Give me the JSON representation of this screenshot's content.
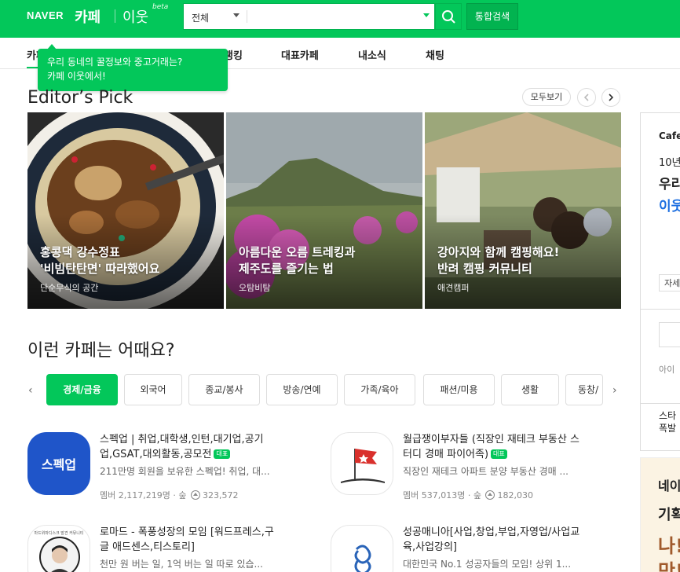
{
  "header": {
    "logo": "NAVER",
    "cafe": "카페",
    "town": "이웃",
    "beta": "beta",
    "search_scope": "전체",
    "search_placeholder": "",
    "integrated_search": "통합검색"
  },
  "nav": {
    "items": [
      "카페",
      "랭킹",
      "대표카페",
      "내소식",
      "채팅"
    ]
  },
  "tooltip": {
    "line1": "우리 동네의 꿀정보와 중고거래는?",
    "line2": "카페 이웃에서!"
  },
  "editors_pick": {
    "title": "Editor’s Pick",
    "view_all": "모두보기",
    "cards": [
      {
        "title1": "홍콩댁 강수정표",
        "title2": "'비빔탄탄면' 따라했어요",
        "sub": "단순무식의 공간"
      },
      {
        "title1": "아름다운 오름 트레킹과",
        "title2": "제주도를 즐기는 법",
        "sub": "오탐비탐"
      },
      {
        "title1": "강아지와 함께 캠핑해요!",
        "title2": "반려 캠핑 커뮤니티",
        "sub": "애견캠퍼"
      }
    ]
  },
  "suggest": {
    "title": "이런 카페는 어때요?",
    "chips": [
      "경제/금융",
      "외국어",
      "종교/봉사",
      "방송/연예",
      "가족/육아",
      "패션/미용",
      "생활",
      "동창/"
    ],
    "cafes": [
      {
        "name1": "스펙업 | 취업,대학생,인턴,대기업,공기",
        "name2": "업,GSAT,대외활동,공모전",
        "badge": "대표",
        "desc": "211만명 회원을 보유한 스펙업! 취업, 대...",
        "members": "멤버 2,117,219명",
        "grade": "숲",
        "rank": "323,572",
        "logo_text": "스펙업"
      },
      {
        "name1": "월급쟁이부자들 (직장인 재테크 부동산 스",
        "name2": "터디 경매 파이어족)",
        "badge": "대표",
        "desc": "직장인 재테크 아파트 분양 부동산 경매 ...",
        "members": "멤버 537,013명",
        "grade": "숲",
        "rank": "182,030"
      },
      {
        "name1": "로마드 - 폭풍성장의 모임 [워드프레스,구",
        "name2": "글 애드센스,티스토리]",
        "desc": "천만 원 버는 일, 1억 버는 일 따로 있습...",
        "thumb_caption": "마드위마디스크 발견 커뮤니티"
      },
      {
        "name1": "성공매니아[사업,창업,부업,자영업/사업교",
        "name2": "육,사업강의]",
        "desc": "대한민국 No.1 성공자들의 모임! 상위 1..."
      }
    ]
  },
  "right": {
    "cafe_label": "Cafe",
    "line_10": "10년",
    "line_u": "우리",
    "line_town": "이웃",
    "line_self": "자세",
    "line_ai": "아이",
    "line_star1": "스타",
    "line_star2": "폭발",
    "ad1": "네이",
    "ad2": "기획",
    "ad3": "나!",
    "ad4": "만!"
  },
  "colors": {
    "brand": "#03c75a"
  },
  "icons": [
    "search-icon",
    "chevron-left-icon",
    "chevron-right-icon",
    "caret-down-icon",
    "rank-up-icon"
  ]
}
